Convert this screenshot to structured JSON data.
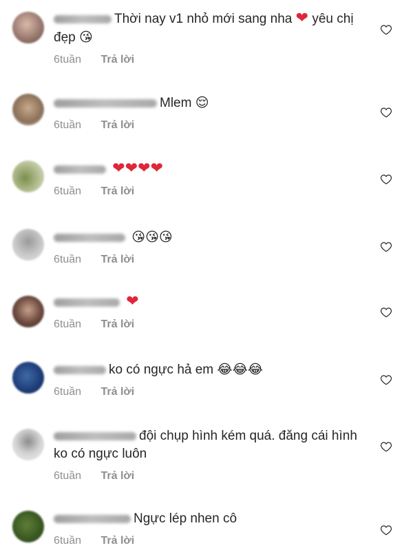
{
  "comments": [
    {
      "text": "Thời nay v1 nhỏ mới sang nha",
      "trail": "yêu chị đẹp",
      "time": "6tuần",
      "reply": "Trả lời"
    },
    {
      "text": "Mlem",
      "time": "6tuần",
      "reply": "Trả lời"
    },
    {
      "text": "",
      "time": "6tuần",
      "reply": "Trả lời"
    },
    {
      "text": "",
      "time": "6tuần",
      "reply": "Trả lời"
    },
    {
      "text": "",
      "time": "6tuần",
      "reply": "Trả lời"
    },
    {
      "text": "ko có ngực hả em",
      "time": "6tuần",
      "reply": "Trả lời"
    },
    {
      "text": "đội chụp hình kém quá. đăng cái hình ko có ngực luôn",
      "time": "6tuần",
      "reply": "Trả lời"
    },
    {
      "text": "Ngực lép nhen cô",
      "time": "6tuần",
      "reply": "Trả lời"
    }
  ],
  "icons": {
    "heart_emoji": "red-heart",
    "kiss_emoji": "face-blowing-kiss",
    "smirk_emoji": "relieved-face",
    "laugh_emoji": "tears-of-joy",
    "like": "heart-outline-icon"
  },
  "colors": {
    "text": "#262626",
    "meta": "#8e8e8e",
    "heart": "#e0263a"
  }
}
